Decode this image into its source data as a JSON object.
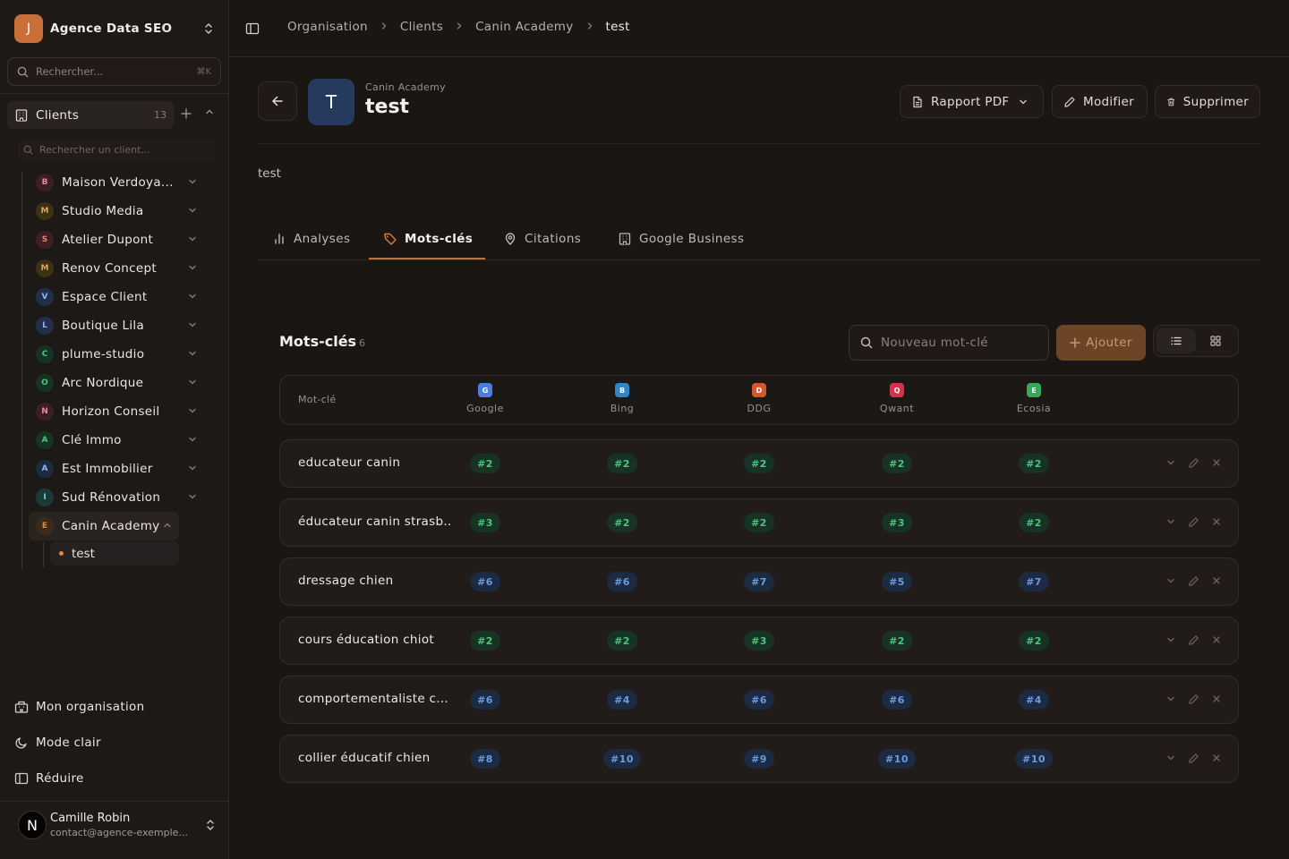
{
  "org": {
    "initial": "J",
    "name": "Agence Data SEO"
  },
  "search": {
    "placeholder": "Rechercher...",
    "shortcut": "⌘K"
  },
  "clients": {
    "label": "Clients",
    "count": "13",
    "search_placeholder": "Rechercher un client...",
    "items": [
      {
        "initial": "B",
        "name": "Maison Verdoya...",
        "bg": "#3a2025",
        "fg": "#e78a9a"
      },
      {
        "initial": "M",
        "name": "Studio Media",
        "bg": "#3d3116",
        "fg": "#d8a94a"
      },
      {
        "initial": "S",
        "name": "Atelier Dupont",
        "bg": "#3d2020",
        "fg": "#e7857d"
      },
      {
        "initial": "M",
        "name": "Renov Concept",
        "bg": "#3d3116",
        "fg": "#d8a94a"
      },
      {
        "initial": "V",
        "name": "Espace Client",
        "bg": "#222f4a",
        "fg": "#93b4ea"
      },
      {
        "initial": "L",
        "name": "Boutique Lila",
        "bg": "#222f4a",
        "fg": "#93b4ea"
      },
      {
        "initial": "C",
        "name": "plume-studio",
        "bg": "#173325",
        "fg": "#4ec27f"
      },
      {
        "initial": "O",
        "name": "Arc Nordique",
        "bg": "#173325",
        "fg": "#4ec27f"
      },
      {
        "initial": "N",
        "name": "Horizon Conseil",
        "bg": "#3a2025",
        "fg": "#e78a9a"
      },
      {
        "initial": "A",
        "name": "Clé Immo",
        "bg": "#173325",
        "fg": "#4ec27f"
      },
      {
        "initial": "A",
        "name": "Est Immobilier",
        "bg": "#1c2a42",
        "fg": "#93b4ea"
      },
      {
        "initial": "I",
        "name": "Sud Rénovation",
        "bg": "#1a3a3a",
        "fg": "#6fd0c8"
      },
      {
        "initial": "E",
        "name": "Canin Academy",
        "bg": "#3d2a18",
        "fg": "#d48b4a"
      }
    ],
    "sub_item": "test"
  },
  "footer": {
    "org_label": "Mon organisation",
    "theme_label": "Mode clair",
    "collapse_label": "Réduire"
  },
  "user": {
    "initial": "N",
    "name": "Camille Robin",
    "email": "contact@agence-exemple..."
  },
  "breadcrumb": [
    "Organisation",
    "Clients",
    "Canin Academy",
    "test"
  ],
  "header": {
    "avatar": "T",
    "parent": "Canin Academy",
    "title": "test",
    "pdf_label": "Rapport PDF",
    "edit_label": "Modifier",
    "delete_label": "Supprimer"
  },
  "description": "test",
  "tabs": [
    "Analyses",
    "Mots-clés",
    "Citations",
    "Google Business"
  ],
  "keywords": {
    "title": "Mots-clés",
    "count": "6",
    "input_placeholder": "Nouveau mot-clé",
    "add_label": "Ajouter",
    "col_keyword": "Mot-clé",
    "engines": [
      {
        "initial": "G",
        "name": "Google",
        "color": "#4a7fe0"
      },
      {
        "initial": "B",
        "name": "Bing",
        "color": "#2e86c9"
      },
      {
        "initial": "D",
        "name": "DDG",
        "color": "#d4572c"
      },
      {
        "initial": "Q",
        "name": "Qwant",
        "color": "#d82f4a"
      },
      {
        "initial": "E",
        "name": "Ecosia",
        "color": "#3aa65a"
      }
    ],
    "rows": [
      {
        "keyword": "educateur canin",
        "ranks": [
          "#2",
          "#2",
          "#2",
          "#2",
          "#2"
        ]
      },
      {
        "keyword": "éducateur canin strasb...",
        "ranks": [
          "#3",
          "#2",
          "#2",
          "#3",
          "#2"
        ]
      },
      {
        "keyword": "dressage chien",
        "ranks": [
          "#6",
          "#6",
          "#7",
          "#5",
          "#7"
        ]
      },
      {
        "keyword": "cours éducation chiot",
        "ranks": [
          "#2",
          "#2",
          "#3",
          "#2",
          "#2"
        ]
      },
      {
        "keyword": "comportementaliste c...",
        "ranks": [
          "#6",
          "#4",
          "#6",
          "#6",
          "#4"
        ]
      },
      {
        "keyword": "collier éducatif chien",
        "ranks": [
          "#8",
          "#10",
          "#9",
          "#10",
          "#10"
        ]
      }
    ]
  }
}
